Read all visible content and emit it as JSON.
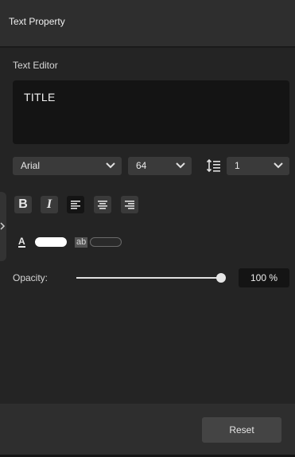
{
  "panel": {
    "title": "Text Property"
  },
  "editor": {
    "section_label": "Text Editor",
    "content": "TITLE"
  },
  "font": {
    "family": "Arial",
    "size": "64",
    "line_spacing": "1",
    "line_spacing_icon": "line-spacing-icon"
  },
  "style": {
    "bold_glyph": "B",
    "italic_glyph": "I",
    "alignment_selected": "left"
  },
  "color": {
    "text_color_glyph": "A",
    "text_color_value": "#ffffff",
    "highlight_glyph": "ab",
    "highlight_color_value": "#2a2a2a"
  },
  "opacity": {
    "label": "Opacity:",
    "display": "100 %",
    "value": 100
  },
  "footer": {
    "reset_label": "Reset"
  }
}
